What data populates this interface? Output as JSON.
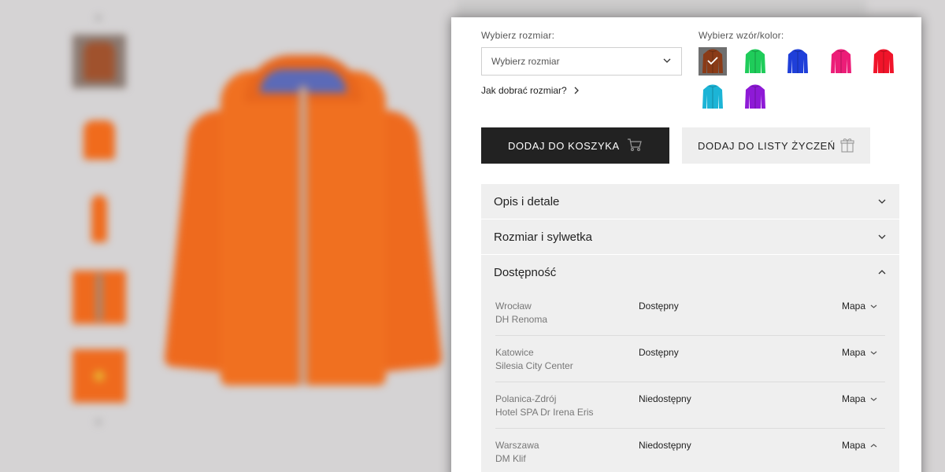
{
  "size": {
    "label": "Wybierz rozmiar:",
    "select_value": "Wybierz rozmiar",
    "help_link": "Jak dobrać rozmiar?"
  },
  "color": {
    "label": "Wybierz wzór/kolor:",
    "swatches": [
      {
        "name": "brown",
        "hex": "#8a3b17",
        "selected": true
      },
      {
        "name": "green",
        "hex": "#1fcc5a",
        "selected": false
      },
      {
        "name": "blue",
        "hex": "#1f3fd9",
        "selected": false
      },
      {
        "name": "pink",
        "hex": "#ec1d78",
        "selected": false
      },
      {
        "name": "red",
        "hex": "#f0142a",
        "selected": false
      },
      {
        "name": "cyan",
        "hex": "#1cb4d6",
        "selected": false
      },
      {
        "name": "purple",
        "hex": "#8e1ad6",
        "selected": false
      }
    ]
  },
  "actions": {
    "cart_label": "DODAJ DO KOSZYKA",
    "wishlist_label": "DODAJ DO LISTY ŻYCZEŃ"
  },
  "accordion": [
    {
      "title": "Opis i detale",
      "open": false
    },
    {
      "title": "Rozmiar i sylwetka",
      "open": false
    },
    {
      "title": "Dostępność",
      "open": true
    }
  ],
  "stores": [
    {
      "city": "Wrocław",
      "shop": "DH Renoma",
      "status": "Dostępny",
      "map": "Mapa",
      "map_open": false
    },
    {
      "city": "Katowice",
      "shop": "Silesia City Center",
      "status": "Dostępny",
      "map": "Mapa",
      "map_open": false
    },
    {
      "city": "Polanica-Zdrój",
      "shop": "Hotel SPA Dr Irena Eris",
      "status": "Niedostępny",
      "map": "Mapa",
      "map_open": false
    },
    {
      "city": "Warszawa",
      "shop": "DM Klif",
      "status": "Niedostępny",
      "map": "Mapa",
      "map_open": true
    }
  ],
  "colors": {
    "background": "#d5d3d4",
    "panel": "#ffffff",
    "accordion_bg": "#efefef",
    "primary_button": "#222222",
    "product_orange": "#f07020"
  }
}
